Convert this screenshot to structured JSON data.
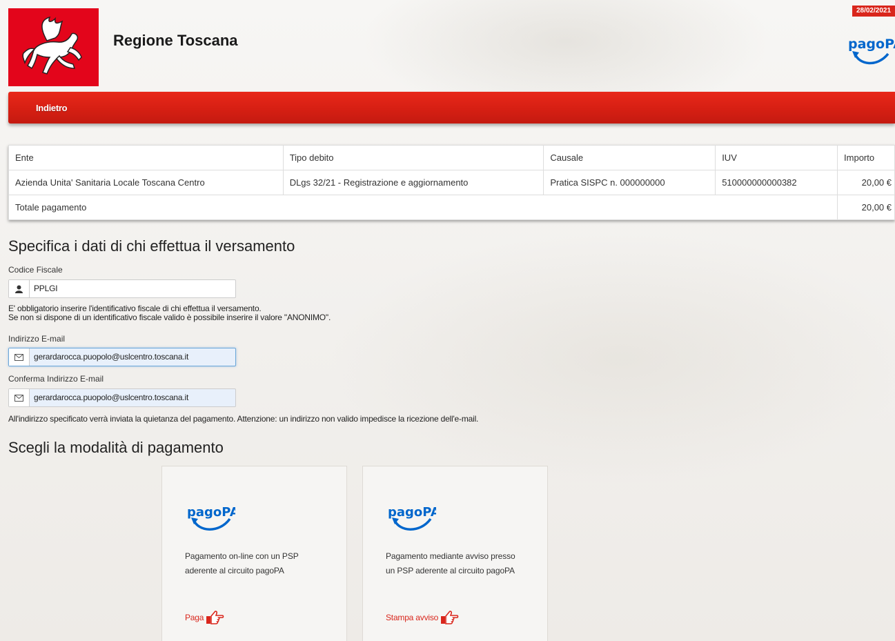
{
  "header": {
    "brand": "Regione Toscana",
    "date_badge": "28/02/2021",
    "pagopa_logo_text": "pagoPA"
  },
  "navbar": {
    "back_label": "Indietro"
  },
  "table": {
    "headers": [
      "Ente",
      "Tipo debito",
      "Causale",
      "IUV",
      "Importo"
    ],
    "rows": [
      [
        "Azienda Unita' Sanitaria Locale Toscana Centro",
        "DLgs 32/21 - Registrazione e aggiornamento",
        "Pratica SISPC n. 000000000",
        "510000000000382",
        "20,00 €"
      ]
    ],
    "total_label": "Totale pagamento",
    "total_value": "20,00 €"
  },
  "form": {
    "title": "Specifica i dati di chi effettua il versamento",
    "cf_label": "Codice Fiscale",
    "cf_value": "PPLGI",
    "cf_help_1": "E' obbligatorio inserire l'identificativo fiscale di chi effettua il versamento.",
    "cf_help_2": "Se non si dispone di un identificativo fiscale valido è possibile inserire il valore \"ANONIMO\".",
    "email_label": "Indirizzo E-mail",
    "email_value": "gerardarocca.puopolo@uslcentro.toscana.it",
    "email_confirm_label": "Conferma Indirizzo E-mail",
    "email_confirm_value": "gerardarocca.puopolo@uslcentro.toscana.it",
    "email_help": "All'indirizzo specificato verrà inviata la quietanza del pagamento. Attenzione: un indirizzo non valido impedisce la ricezione dell'e-mail."
  },
  "payment": {
    "title": "Scegli la modalità di pagamento",
    "cards": [
      {
        "logo": "pagoPA",
        "description": "Pagamento on-line con un PSP aderente al circuito pagoPA",
        "action": "Paga"
      },
      {
        "logo": "pagoPA",
        "description": "Pagamento mediante avviso presso un PSP aderente al circuito pagoPA",
        "action": "Stampa avviso"
      }
    ]
  },
  "colors": {
    "brand_red": "#e3051b",
    "nav_red": "#d61f13",
    "link_red": "#d9261c",
    "pagopa_blue": "#0066cc"
  },
  "icons": [
    "pegasus-logo",
    "user-icon",
    "envelope-icon",
    "pointing-hand-icon"
  ]
}
